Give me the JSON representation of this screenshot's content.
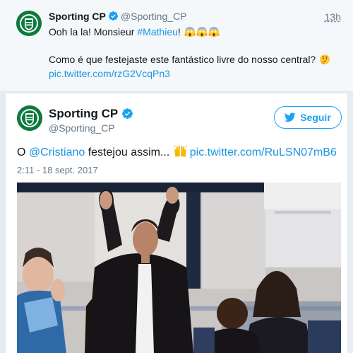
{
  "top_tweet": {
    "name": "Sporting CP",
    "handle": "@Sporting_CP",
    "time": "13h",
    "line1_prefix": "Ooh la la! Monsieur ",
    "hashtag": "#Mathieu",
    "line1_suffix": "!",
    "line2": "Como é que festejaste este fantástico livre do nosso central?",
    "link": "pic.twitter.com/rzG2VcqPn3",
    "line1_emojis": [
      "face-screaming-icon",
      "face-screaming-icon",
      "face-screaming-icon"
    ],
    "line2_emoji": "thinking-face-icon"
  },
  "main_tweet": {
    "name": "Sporting CP",
    "handle": "@Sporting_CP",
    "follow_label": "Seguir",
    "text_prefix": "O ",
    "mention": "@Cristiano",
    "text_middle": " festejou assim... ",
    "link": "pic.twitter.com/RuLSN07mB6",
    "date": "2:11 - 18 sept. 2017",
    "media_alt": "video-still-celebration"
  },
  "colors": {
    "link": "#1b95e0",
    "twitter_blue": "#1da1f2",
    "sporting_green": "#0d7a3e",
    "muted": "#657786"
  }
}
